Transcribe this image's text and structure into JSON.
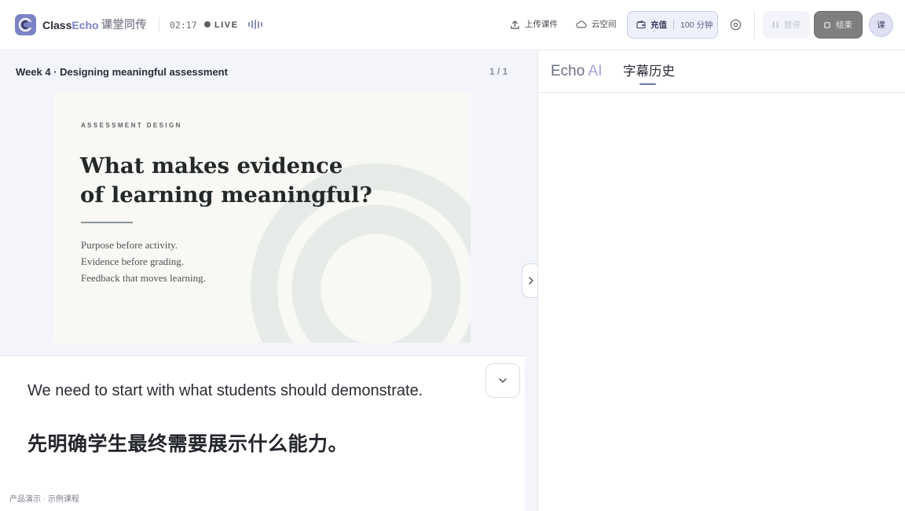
{
  "header": {
    "brand_class": "Class",
    "brand_echo": "Echo",
    "brand_cn": "课堂同传",
    "timer": "02:17",
    "live_label": "LIVE",
    "upload_label": "上传课件",
    "cloud_label": "云空间",
    "recharge_label": "充值",
    "minutes_label": "100 分钟",
    "pause_label": "暂停",
    "end_label": "结束",
    "avatar_label": "课"
  },
  "slide_panel": {
    "lecture_title": "Week 4 · Designing meaningful assessment",
    "page_count": "1 / 1",
    "slide": {
      "eyebrow": "ASSESSMENT DESIGN",
      "heading_line1": "What makes evidence",
      "heading_line2": "of learning meaningful?",
      "points": [
        "Purpose before activity.",
        "Evidence before grading.",
        "Feedback that moves learning."
      ]
    }
  },
  "captions": {
    "english": "We need to start with what students should demonstrate.",
    "chinese": "先明确学生最终需要展示什么能力。",
    "footer_note": "产品演示 · 示例课程"
  },
  "right_panel": {
    "tab_echo_prefix": "Echo",
    "tab_echo_suffix": "AI",
    "tab_history": "字幕历史"
  },
  "colors": {
    "brand_accent": "#7c82c6",
    "recharge_bg": "#eef0fb",
    "end_button": "#7f7f7f",
    "slide_bg": "#f8f8f5",
    "ring": "#e6ebe7"
  },
  "icons": [
    "classecho-logo-icon",
    "sound-wave-icon",
    "upload-icon",
    "cloud-icon",
    "wallet-icon",
    "settings-icon",
    "pause-icon",
    "stop-icon",
    "chevron-down-icon",
    "chevron-right-icon"
  ]
}
